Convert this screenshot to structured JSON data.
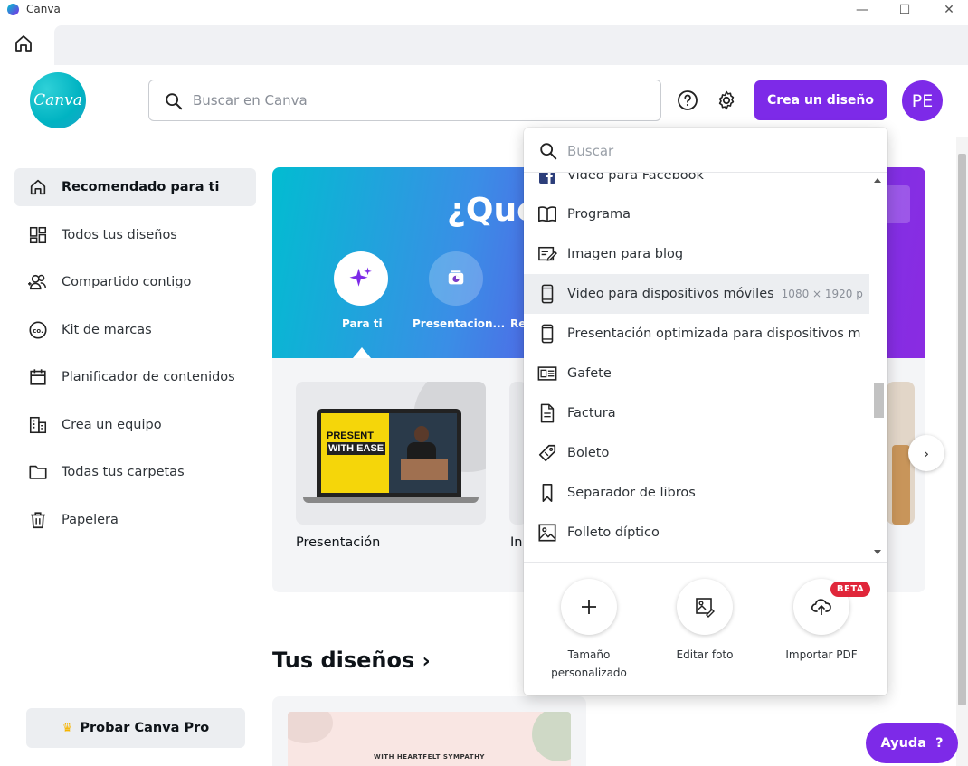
{
  "window": {
    "app_name": "Canva",
    "minimize": "—",
    "maximize": "☐",
    "close": "✕"
  },
  "header": {
    "logo_text": "Canva",
    "search_placeholder": "Buscar en Canva",
    "create_button": "Crea un diseño",
    "avatar_initials": "PE",
    "brand_color": "#7d2ae8"
  },
  "sidebar": {
    "items": [
      {
        "label": "Recomendado para ti",
        "icon": "home-icon",
        "active": true
      },
      {
        "label": "Todos tus diseños",
        "icon": "grid-icon"
      },
      {
        "label": "Compartido contigo",
        "icon": "shared-users-icon"
      },
      {
        "label": "Kit de marcas",
        "icon": "brand-kit-icon"
      },
      {
        "label": "Planificador de contenidos",
        "icon": "calendar-icon"
      },
      {
        "label": "Crea un equipo",
        "icon": "team-building-icon"
      },
      {
        "label": "Todas tus carpetas",
        "icon": "folder-icon"
      },
      {
        "label": "Papelera",
        "icon": "trash-icon"
      }
    ],
    "pro_button": "Probar Canva Pro"
  },
  "banner": {
    "title": "¿Qué",
    "categories": [
      {
        "label": "Para ti",
        "icon": "sparkle-icon"
      },
      {
        "label": "Presentacion...",
        "icon": "presentation-icon"
      },
      {
        "label": "Re"
      }
    ]
  },
  "cards": [
    {
      "label": "Presentación",
      "thumb_text": "PRESENT WITH EASE"
    },
    {
      "label": "In"
    }
  ],
  "thumb": {
    "line1": "PRESENT",
    "line2": "WITH EASE"
  },
  "section": {
    "title": "Tus diseños",
    "chevron": "›"
  },
  "design_card": {
    "text": "WITH HEARTFELT SYMPATHY"
  },
  "help_button": "Ayuda",
  "help_mark": "?",
  "dropdown": {
    "search_placeholder": "Buscar",
    "items": [
      {
        "label": "Video para Facebook",
        "icon": "facebook-icon"
      },
      {
        "label": "Programa",
        "icon": "book-icon"
      },
      {
        "label": "Imagen para blog",
        "icon": "blog-edit-icon"
      },
      {
        "label": "Video para dispositivos móviles",
        "sub": "1080 × 1920 p",
        "icon": "mobile-icon",
        "hover": true
      },
      {
        "label": "Presentación optimizada para dispositivos m",
        "icon": "mobile-icon"
      },
      {
        "label": "Gafete",
        "icon": "badge-icon"
      },
      {
        "label": "Factura",
        "icon": "document-icon"
      },
      {
        "label": "Boleto",
        "icon": "ticket-icon"
      },
      {
        "label": "Separador de libros",
        "icon": "bookmark-icon"
      },
      {
        "label": "Folleto díptico",
        "icon": "image-icon"
      }
    ],
    "actions": [
      {
        "label": "Tamaño personalizado",
        "icon": "plus-icon"
      },
      {
        "label": "Editar foto",
        "icon": "edit-photo-icon"
      },
      {
        "label": "Importar PDF",
        "icon": "cloud-upload-icon"
      }
    ],
    "beta_badge": "BETA"
  }
}
